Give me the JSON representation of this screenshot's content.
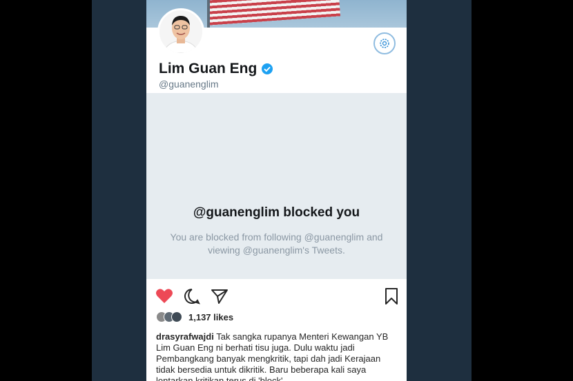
{
  "profile": {
    "name": "Lim Guan Eng",
    "handle": "@guanenglim"
  },
  "blocked": {
    "title": "@guanenglim blocked you",
    "message": "You are blocked from following @guanenglim and viewing @guanenglim's Tweets."
  },
  "post": {
    "likes": "1,137 likes",
    "username": "drasyrafwajdi",
    "caption": "Tak sangka rupanya Menteri Kewangan YB Lim Guan Eng ni berhati tisu juga. Dulu waktu jadi Pembangkang banyak mengkritik, tapi dah jadi Kerajaan tidak bersedia untuk dikritik. Baru beberapa kali saya lontarkan kritikan terus di 'block'"
  },
  "icons": {
    "like": "heart-icon",
    "comment": "comment-icon",
    "share": "send-icon",
    "save": "bookmark-icon",
    "settings": "gear-icon",
    "verified": "verified-badge-icon"
  },
  "colors": {
    "background": "#1e2f3f",
    "like": "#ed4956",
    "verified": "#1da1f2",
    "panel": "#e6ecf0"
  }
}
